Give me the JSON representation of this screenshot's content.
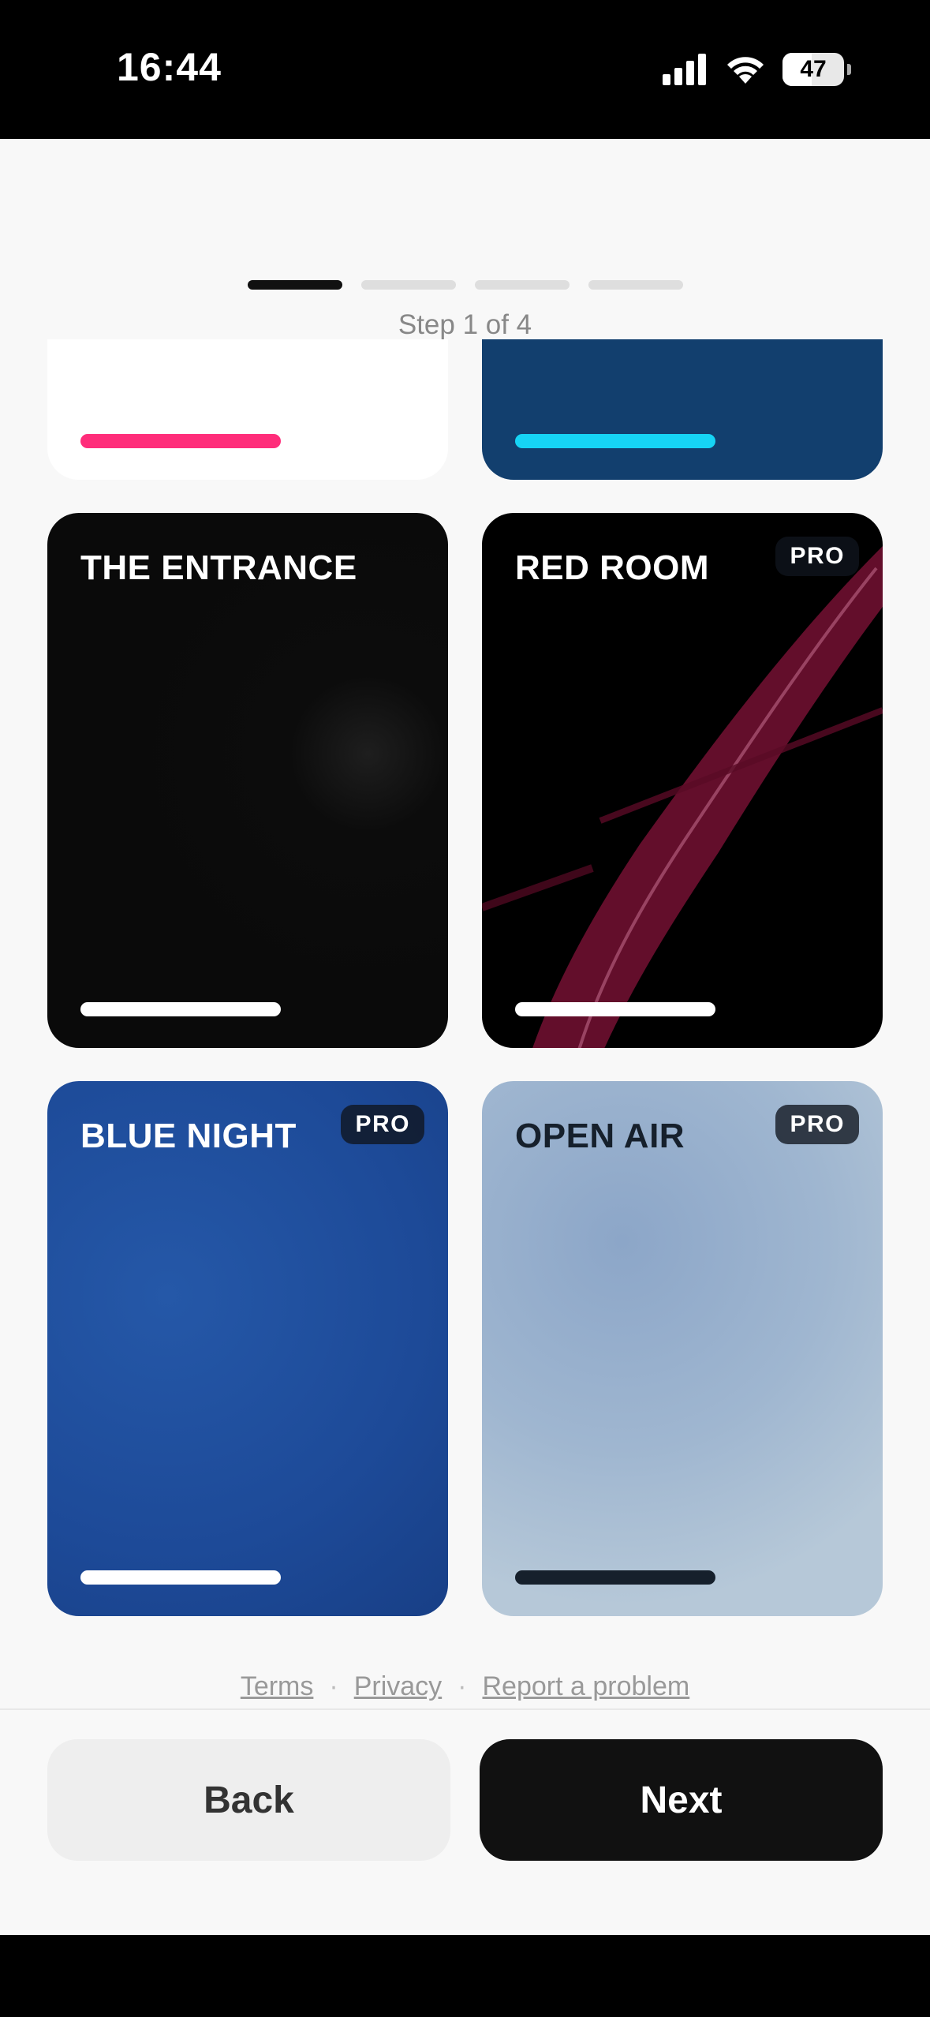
{
  "status_bar": {
    "time": "16:44",
    "battery": "47"
  },
  "progress": {
    "steps_total": 4,
    "current_step": 1,
    "label": "Step 1 of 4"
  },
  "cards": {
    "top_left": {
      "bar_color": "#ff2d7a"
    },
    "top_right": {
      "bar_color": "#16d4f5"
    },
    "entrance": {
      "title": "THE ENTRANCE"
    },
    "red_room": {
      "title": "RED ROOM",
      "badge": "PRO"
    },
    "blue_night": {
      "title": "BLUE NIGHT",
      "badge": "PRO"
    },
    "open_air": {
      "title": "OPEN AIR",
      "badge": "PRO"
    }
  },
  "footer": {
    "terms": "Terms",
    "privacy": "Privacy",
    "report": "Report a problem",
    "separator": "·"
  },
  "buttons": {
    "back": "Back",
    "next": "Next"
  },
  "colors": {
    "accent_dark": "#111111",
    "background": "#f8f8f8",
    "pro_badge": "#0f141e"
  }
}
